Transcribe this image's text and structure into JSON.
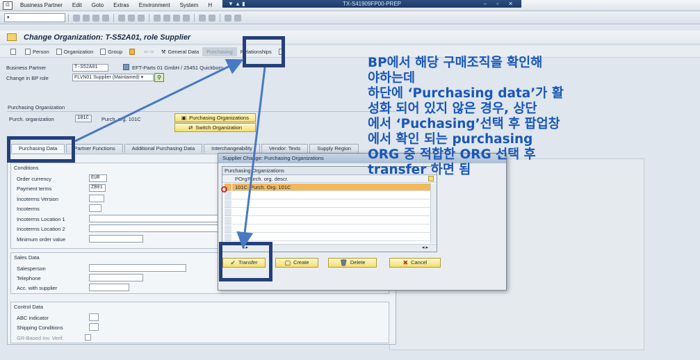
{
  "window": {
    "title": "TX-S41909FP00-PREP",
    "controls": "– ▫ ✕"
  },
  "menu": [
    "Business Partner",
    "Edit",
    "Goto",
    "Extras",
    "Environment",
    "System",
    "H"
  ],
  "page_title": "Change Organization: T-S52A01, role Supplier",
  "app_toolbar": {
    "person": "Person",
    "organization": "Organization",
    "group": "Group",
    "general_data": "General Data",
    "purchasing": "Purchasing",
    "relationships": "Relationships"
  },
  "header_fields": {
    "bp_label": "Business Partner",
    "bp_value": "T-S52A01",
    "bp_desc": "EFT-Parts 01 GmbH / 25451 Quickborn",
    "role_label": "Change in BP role",
    "role_value": "FLVN01 Supplier (Maintained)"
  },
  "purch_org": {
    "group_title": "Purchasing Organization",
    "label": "Purch. organization",
    "value": "101C",
    "desc": "Purch. org. 101C",
    "btn_purch_orgs": "Purchasing Organizations",
    "btn_switch": "Switch Organization"
  },
  "tabs": [
    "Purchasing Data",
    "Partner Functions",
    "Additional Purchasing Data",
    "Interchangeability",
    "Vendor: Texts",
    "Supply Region"
  ],
  "conditions": {
    "title": "Conditions",
    "order_currency_label": "Order currency",
    "order_currency": "EUR",
    "payment_terms_label": "Payment terms",
    "payment_terms": "ZB01",
    "incoterms_version": "Incoterms Version",
    "incoterms": "Incoterms",
    "incoterms_loc1": "Incoterms Location 1",
    "incoterms_loc2": "Incoterms Location 2",
    "min_order_value": "Minimum order value"
  },
  "sales_data": {
    "title": "Sales Data",
    "salesperson": "Salesperson",
    "telephone": "Telephone",
    "acc_with_supplier": "Acc. with supplier"
  },
  "control_data": {
    "title": "Control Data",
    "abc_indicator": "ABC indicator",
    "shipping_conditions": "Shipping Conditions",
    "gr_based_inv": "GR-Based Inv. Verif."
  },
  "dialog": {
    "title": "Supplier Change: Purchasing Organizations",
    "table_title": "Purchasing Organizations",
    "col_porg": "POrg",
    "col_descr": "Purch. org. descr.",
    "rows": [
      {
        "porg": "101C",
        "descr": "Purch. Org. 101C"
      }
    ],
    "btn_transfer": "Transfer",
    "btn_create": "Create",
    "btn_delete": "Delete",
    "btn_cancel": "Cancel"
  },
  "annotation": {
    "lines": [
      "BP에서 해당 구매조직을 확인해",
      "야하는데",
      "하단에 ‘Purchasing data’가 활",
      "성화 되어 있지 않은 경우, 상단",
      "에서 ‘Puchasing’선택 후 팝업창",
      "에서 확인 되는 purchasing",
      "ORG 중 적합한 ORG 선택 후",
      "transfer 하면 됨"
    ],
    "color": "#1a57b8"
  },
  "colors": {
    "highlight_box": "#24407a",
    "selected_row": "#f2b85a",
    "button_yellow": "#f3de71"
  }
}
